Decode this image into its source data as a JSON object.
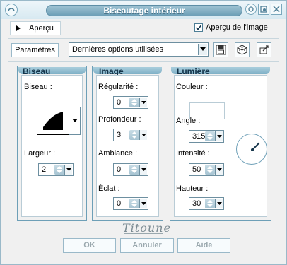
{
  "window": {
    "title": "Biseautage intérieur"
  },
  "preview": {
    "tab_label": "Aperçu",
    "checkbox_label": "Aperçu de l'image",
    "checked": true
  },
  "params": {
    "label": "Paramètres",
    "preset_value": "Dernières options utilisées"
  },
  "bevel": {
    "title": "Biseau",
    "bevel_label": "Biseau :",
    "width_label": "Largeur :",
    "width_value": "2"
  },
  "image": {
    "title": "Image",
    "smoothness_label": "Régularité :",
    "smoothness_value": "0",
    "depth_label": "Profondeur :",
    "depth_value": "3",
    "ambience_label": "Ambiance :",
    "ambience_value": "0",
    "shine_label": "Éclat :",
    "shine_value": "0"
  },
  "light": {
    "title": "Lumière",
    "color_label": "Couleur :",
    "color_value": "#ffffff",
    "angle_label": "Angle :",
    "angle_value": "315",
    "intensity_label": "Intensité :",
    "intensity_value": "50",
    "height_label": "Hauteur :",
    "height_value": "30"
  },
  "signature": "Titoune",
  "buttons": {
    "ok": "OK",
    "cancel": "Annuler",
    "help": "Aide"
  },
  "colors": {
    "accent": "#6d9fb7",
    "title_text": "#ffffff",
    "disabled_text": "#9aa8ae"
  }
}
